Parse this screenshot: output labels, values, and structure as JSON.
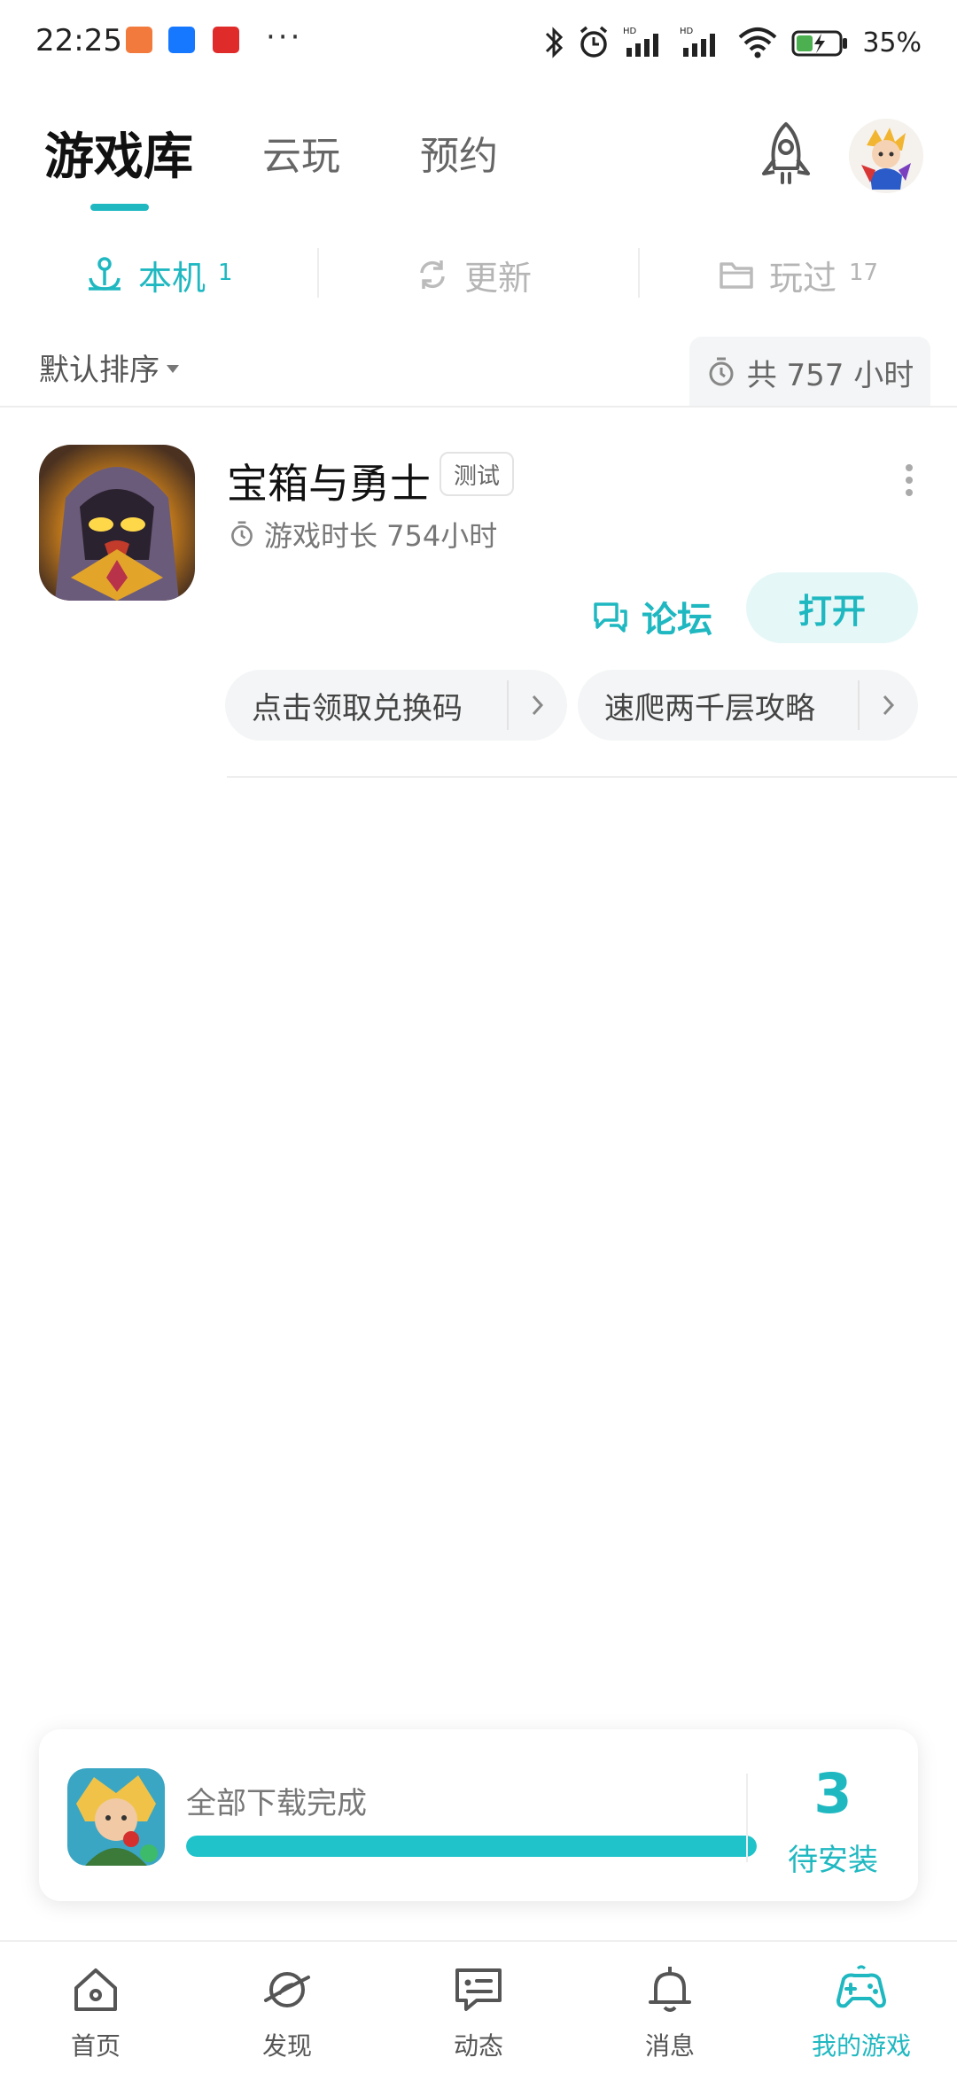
{
  "status_bar": {
    "time": "22:25",
    "dots": "···",
    "battery": "35%"
  },
  "header": {
    "tabs": [
      {
        "label": "游戏库",
        "active": true
      },
      {
        "label": "云玩",
        "active": false
      },
      {
        "label": "预约",
        "active": false
      }
    ]
  },
  "subtabs": [
    {
      "label": "本机",
      "count": "1",
      "icon": "anchor-icon",
      "active": true
    },
    {
      "label": "更新",
      "count": "",
      "icon": "refresh-icon",
      "active": false
    },
    {
      "label": "玩过",
      "count": "17",
      "icon": "folder-icon",
      "active": false
    }
  ],
  "sort": {
    "label": "默认排序",
    "total_label": "共 757 小时"
  },
  "game": {
    "title": "宝箱与勇士",
    "badge": "测试",
    "playtime": "游戏时长 754小时",
    "forum_label": "论坛",
    "open_label": "打开",
    "chips": [
      "点击领取兑换码",
      "速爬两千层攻略"
    ]
  },
  "download": {
    "status": "全部下载完成",
    "progress": 1.0,
    "pending_count": "3",
    "pending_label": "待安装"
  },
  "bottom_nav": [
    {
      "label": "首页",
      "icon": "home-icon",
      "active": false
    },
    {
      "label": "发现",
      "icon": "planet-icon",
      "active": false
    },
    {
      "label": "动态",
      "icon": "chat-icon",
      "active": false
    },
    {
      "label": "消息",
      "icon": "bell-icon",
      "active": false
    },
    {
      "label": "我的游戏",
      "icon": "gamepad-icon",
      "active": true
    }
  ],
  "colors": {
    "accent": "#1fb8c1",
    "accent_light": "#e6f7f8"
  }
}
